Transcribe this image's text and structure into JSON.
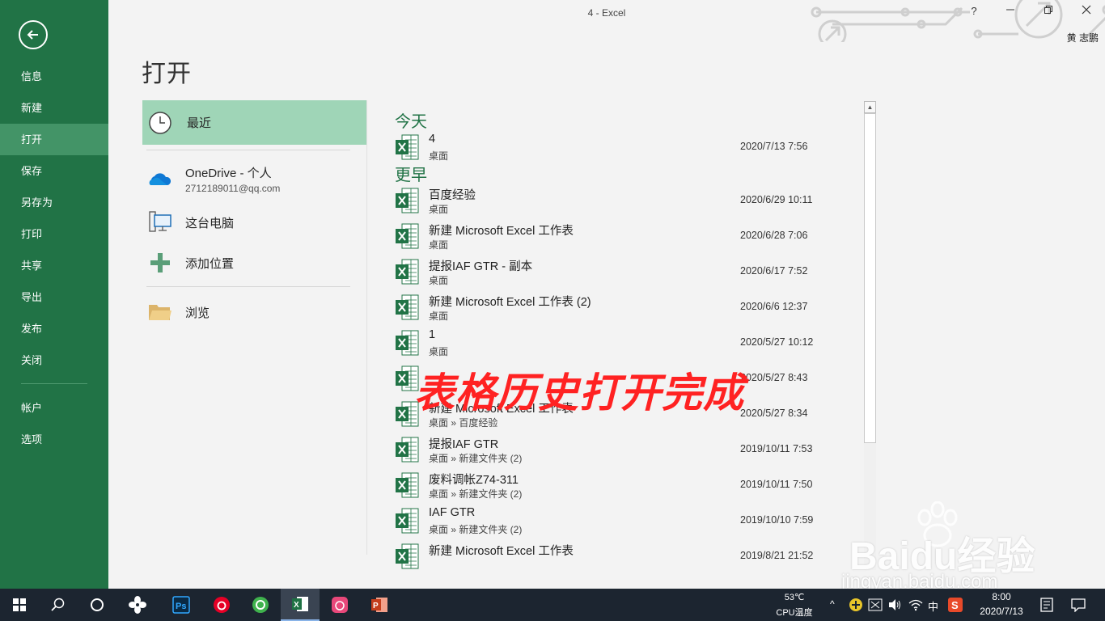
{
  "window": {
    "title": "4 - Excel",
    "help": "?",
    "user": "黄 志鹏"
  },
  "nav": {
    "items": [
      "信息",
      "新建",
      "打开",
      "保存",
      "另存为",
      "打印",
      "共享",
      "导出",
      "发布",
      "关闭"
    ],
    "bottom_items": [
      "帐户",
      "选项"
    ],
    "active": "打开"
  },
  "page_title": "打开",
  "locations": {
    "recent": "最近",
    "onedrive": {
      "label": "OneDrive - 个人",
      "email": "2712189011@qq.com"
    },
    "this_pc": "这台电脑",
    "add_place": "添加位置",
    "browse": "浏览"
  },
  "groups": {
    "today": "今天",
    "earlier": "更早"
  },
  "files_today": [
    {
      "name": "4",
      "path": "桌面",
      "date": "2020/7/13 7:56"
    }
  ],
  "files_earlier": [
    {
      "name": "百度经验",
      "path": "桌面",
      "date": "2020/6/29 10:11"
    },
    {
      "name": "新建 Microsoft Excel 工作表",
      "path": "桌面",
      "date": "2020/6/28 7:06"
    },
    {
      "name": "提报IAF GTR - 副本",
      "path": "桌面",
      "date": "2020/6/17 7:52"
    },
    {
      "name": "新建 Microsoft Excel 工作表 (2)",
      "path": "桌面",
      "date": "2020/6/6 12:37"
    },
    {
      "name": "1",
      "path": "桌面",
      "date": "2020/5/27 10:12"
    },
    {
      "name": "",
      "path": "",
      "date": "2020/5/27 8:43"
    },
    {
      "name": "新建 Microsoft Excel 工作表",
      "path": "桌面 » 百度经验",
      "date": "2020/5/27 8:34"
    },
    {
      "name": "提报IAF GTR",
      "path": "桌面 » 新建文件夹 (2)",
      "date": "2019/10/11 7:53"
    },
    {
      "name": "废料调帐Z74-311",
      "path": "桌面 » 新建文件夹 (2)",
      "date": "2019/10/11 7:50"
    },
    {
      "name": "IAF GTR",
      "path": "桌面 » 新建文件夹 (2)",
      "date": "2019/10/10 7:59"
    },
    {
      "name": "新建 Microsoft Excel 工作表",
      "path": "",
      "date": "2019/8/21 21:52"
    }
  ],
  "overlay_caption": "表格历史打开完成",
  "watermark": {
    "main": "Baidu经验",
    "sub": "jingyan.baidu.com"
  },
  "taskbar": {
    "temp": "53℃",
    "temp_label": "CPU温度",
    "ime": "中",
    "time": "8:00",
    "date": "2020/7/13"
  },
  "colors": {
    "accent": "#217346",
    "nav_active": "#439467",
    "recent_bg": "#9fd5b7",
    "overlay": "#ff2222"
  }
}
